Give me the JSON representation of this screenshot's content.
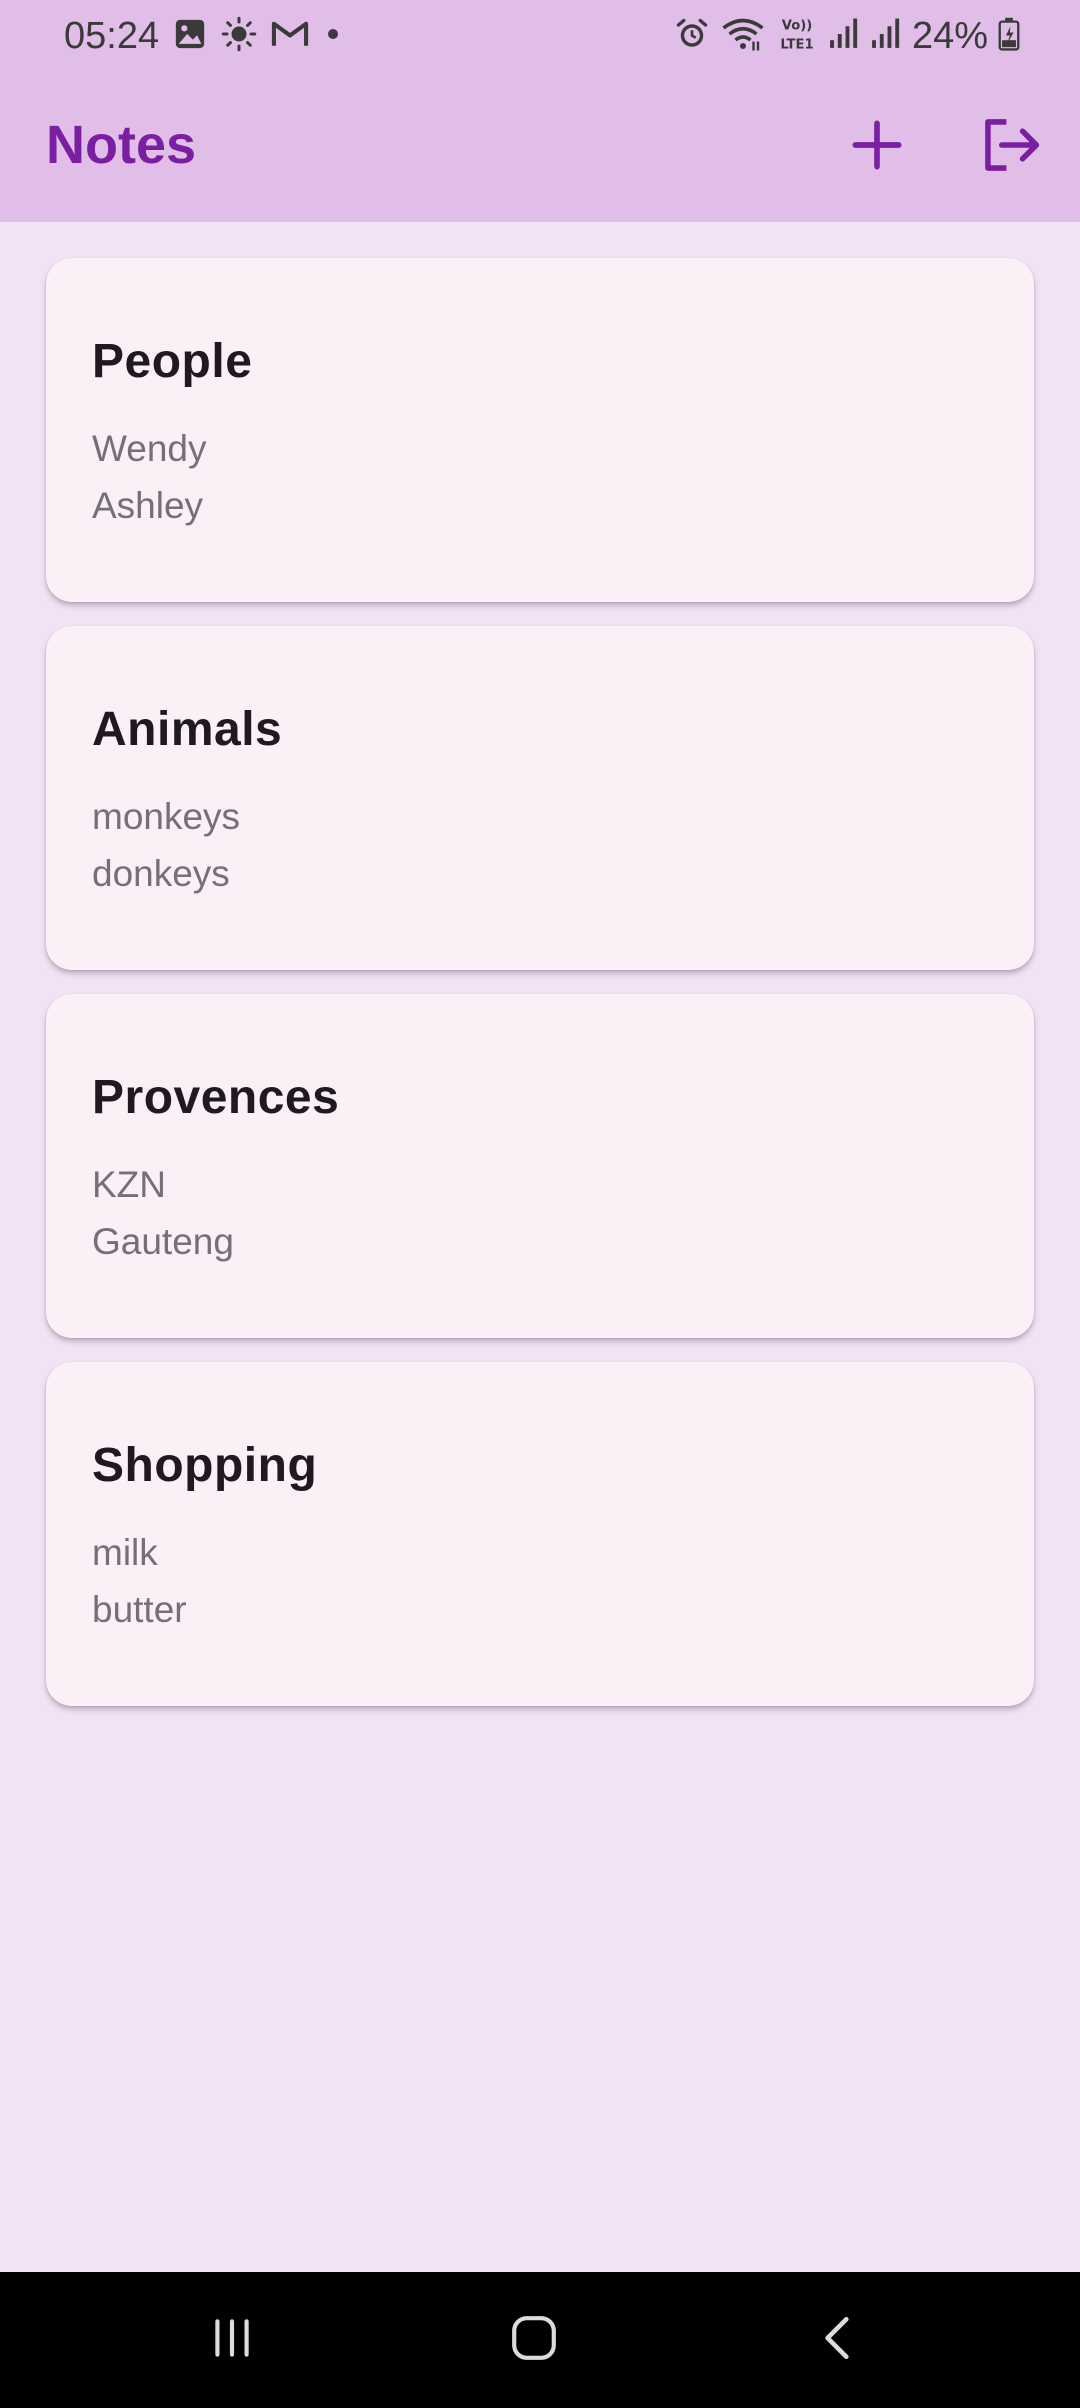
{
  "status_bar": {
    "time": "05:24",
    "battery_percent": "24%",
    "left_icons": [
      "gallery-icon",
      "brightness-icon",
      "gmail-icon",
      "dot-icon"
    ],
    "right_icons": [
      "alarm-icon",
      "wifi-icon",
      "volte-icon",
      "signal-icon",
      "signal-icon",
      "battery-icon"
    ]
  },
  "app_bar": {
    "title": "Notes",
    "actions": [
      "add-icon",
      "logout-icon"
    ]
  },
  "notes": [
    {
      "title": "People",
      "lines": [
        "Wendy",
        "Ashley"
      ]
    },
    {
      "title": "Animals",
      "lines": [
        "monkeys",
        "donkeys"
      ]
    },
    {
      "title": "Provences",
      "lines": [
        "KZN",
        "Gauteng"
      ]
    },
    {
      "title": "Shopping",
      "lines": [
        "milk",
        "butter"
      ]
    }
  ],
  "nav_bar": {
    "buttons": [
      "recents-icon",
      "home-icon",
      "back-icon"
    ]
  },
  "colors": {
    "app_bar_bg": "#e1bee7",
    "title_color": "#7b1fa2",
    "page_bg": "#f1e3f4",
    "card_bg": "#fbf0f5"
  }
}
